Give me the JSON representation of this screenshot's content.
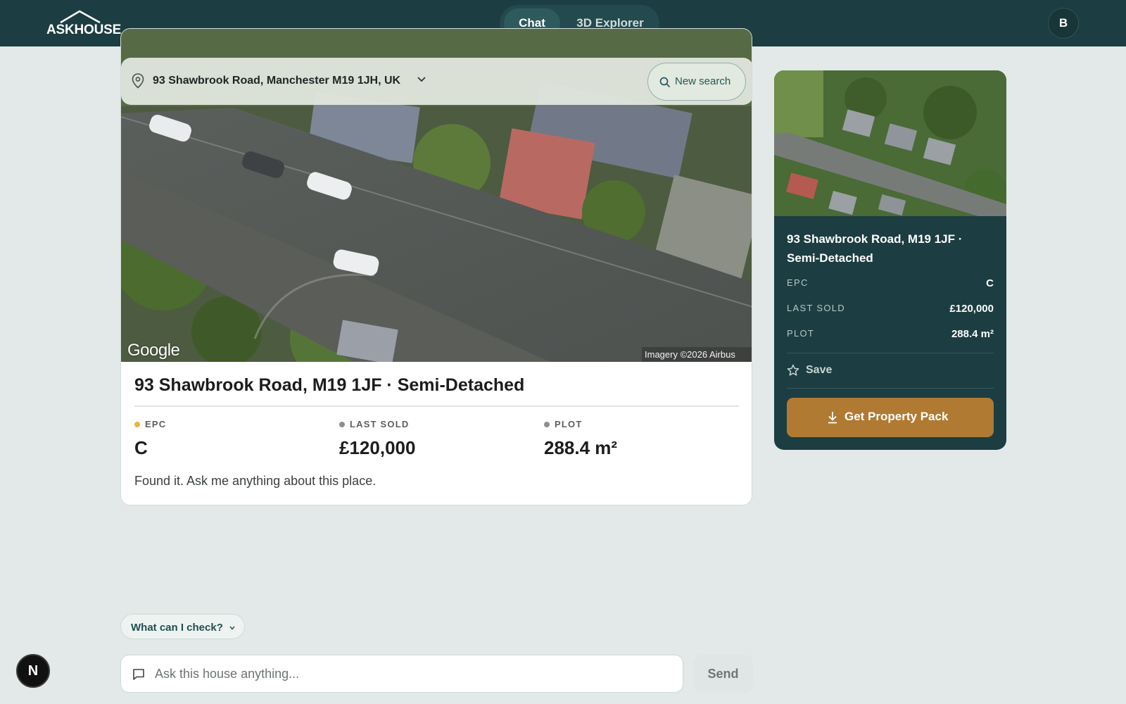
{
  "header": {
    "logo_text": "ASKHOUSE",
    "tabs": [
      {
        "label": "Chat",
        "active": true
      },
      {
        "label": "3D Explorer",
        "active": false
      }
    ],
    "avatar_initial": "B"
  },
  "search": {
    "address": "93 Shawbrook Road, Manchester M19 1JH, UK",
    "new_search_label": "New search",
    "icons": [
      "pin-icon",
      "chevron-down-icon",
      "search-icon"
    ]
  },
  "map": {
    "provider_mark": "Google",
    "imagery_credit": "Imagery ©2026 Airbus"
  },
  "property": {
    "title": "93 Shawbrook Road, M19 1JF · Semi-Detached",
    "stats": [
      {
        "label": "EPC",
        "value": "C",
        "dot_color": "#e6b53a"
      },
      {
        "label": "LAST SOLD",
        "value": "£120,000",
        "dot_color": "#8c908e"
      },
      {
        "label": "PLOT",
        "value": "288.4 m²",
        "dot_color": "#8c908e"
      }
    ],
    "message": "Found it. Ask me anything about this place."
  },
  "side_card": {
    "title": "93 Shawbrook Road, M19 1JF · Semi-Detached",
    "rows": [
      {
        "label": "EPC",
        "value": "C"
      },
      {
        "label": "LAST SOLD",
        "value": "£120,000"
      },
      {
        "label": "PLOT",
        "value": "288.4 m²"
      }
    ],
    "save_label": "Save",
    "pack_label": "Get Property Pack"
  },
  "chat": {
    "suggest_label": "What can I check?",
    "input_placeholder": "Ask this house anything...",
    "input_value": "",
    "send_label": "Send"
  },
  "dev_badge": "N",
  "colors": {
    "header_bg": "#1c3d41",
    "page_bg": "#e2e9e8",
    "accent_button": "#b07a33",
    "epc_dot": "#e6b53a"
  }
}
